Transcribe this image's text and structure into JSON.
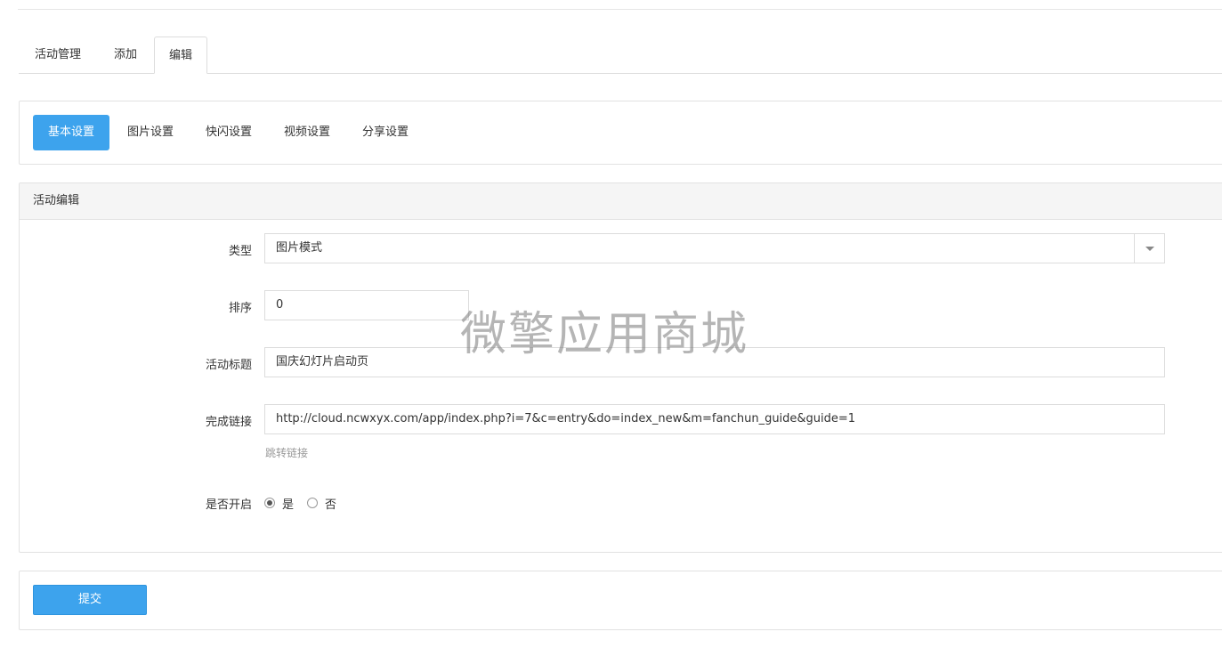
{
  "top_tabs": [
    {
      "label": "活动管理",
      "active": false
    },
    {
      "label": "添加",
      "active": false
    },
    {
      "label": "编辑",
      "active": true
    }
  ],
  "sub_nav": [
    {
      "label": "基本设置",
      "active": true
    },
    {
      "label": "图片设置",
      "active": false
    },
    {
      "label": "快闪设置",
      "active": false
    },
    {
      "label": "视频设置",
      "active": false
    },
    {
      "label": "分享设置",
      "active": false
    }
  ],
  "panel": {
    "heading": "活动编辑"
  },
  "form": {
    "type": {
      "label": "类型",
      "value": "图片模式"
    },
    "order": {
      "label": "排序",
      "value": "0"
    },
    "title": {
      "label": "活动标题",
      "value": "国庆幻灯片启动页"
    },
    "link": {
      "label": "完成链接",
      "value": "http://cloud.ncwxyx.com/app/index.php?i=7&c=entry&do=index_new&m=fanchun_guide&guide=1",
      "help": "跳转链接"
    },
    "enabled": {
      "label": "是否开启",
      "options": [
        {
          "label": "是",
          "checked": true
        },
        {
          "label": "否",
          "checked": false
        }
      ]
    }
  },
  "submit": {
    "label": "提交"
  },
  "watermark": "微擎应用商城",
  "colors": {
    "accent": "#3da3ed",
    "border": "#e2e2e2",
    "heading_bg": "#f5f5f5"
  }
}
